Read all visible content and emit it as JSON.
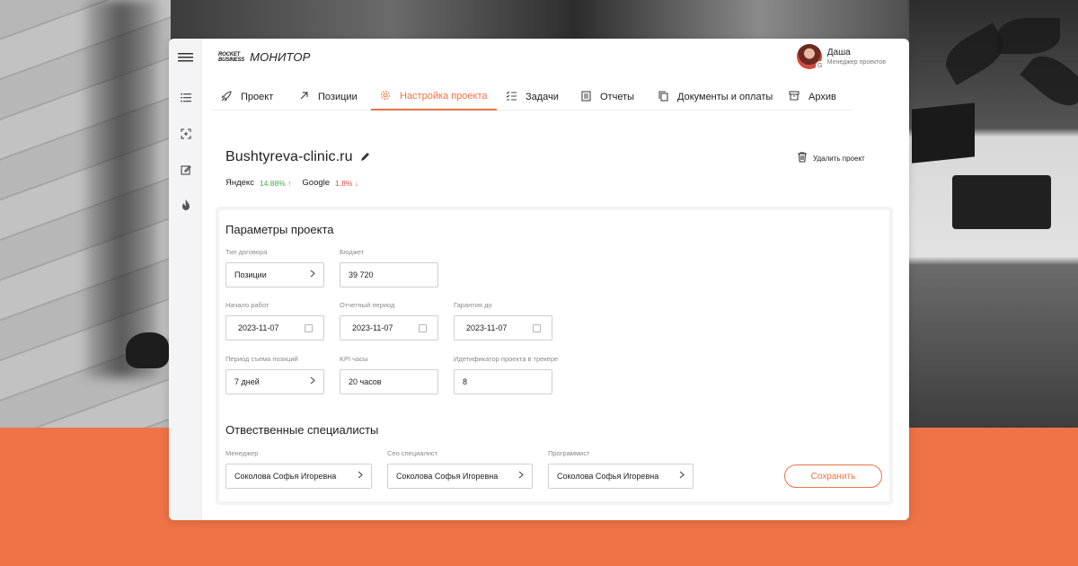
{
  "header": {
    "logo_small_1": "ROCKET",
    "logo_small_2": "BUSINESS",
    "logo_title": "МОНИТОР",
    "user_name": "Даша",
    "user_role": "Менеджер проектов",
    "avatar_badge": "G"
  },
  "sidebar": {
    "icons": [
      "menu-icon",
      "list-icon",
      "scan-icon",
      "edit-icon",
      "flame-icon"
    ]
  },
  "tabs": [
    {
      "label": "Проект",
      "icon": "rocket-icon"
    },
    {
      "label": "Позиции",
      "icon": "arrow-up-right-icon"
    },
    {
      "label": "Настройка проекта",
      "icon": "gear-icon",
      "active": true
    },
    {
      "label": "Задачи",
      "icon": "checklist-icon"
    },
    {
      "label": "Отчеты",
      "icon": "document-icon"
    },
    {
      "label": "Документы и оплаты",
      "icon": "copy-icon"
    },
    {
      "label": "Архив",
      "icon": "archive-icon"
    }
  ],
  "project": {
    "title": "Bushtyreva-clinic.ru",
    "delete_label": "Удалить проект",
    "stats": {
      "yandex_label": "Яндекс",
      "yandex_value": "14.88% ↑",
      "google_label": "Google",
      "google_value": "1.8% ↓"
    }
  },
  "params": {
    "title": "Параметры проекта",
    "contract_type_label": "Тип договора",
    "contract_type_value": "Позиции",
    "budget_label": "Бюджет",
    "budget_value": "39 720",
    "start_label": "Начало работ",
    "start_value": "2023-11-07",
    "report_label": "Отчетный период",
    "report_value": "2023-11-07",
    "warranty_label": "Гарантия до",
    "warranty_value": "2023-11-07",
    "period_label": "Период съема позиций",
    "period_value": "7 дней",
    "kpi_label": "KPI часы",
    "kpi_value": "20 часов",
    "tracker_label": "Идетификатор проекта в трекере",
    "tracker_value": "8"
  },
  "specialists": {
    "title": "Отвественные специалисты",
    "manager_label": "Менеджер",
    "manager_value": "Соколова Софья Игоревна",
    "seo_label": "Сео специалист",
    "seo_value": "Соколова Софья Игоревна",
    "dev_label": "Программист",
    "dev_value": "Соколова Софья Игоревна",
    "save_label": "Сохранить"
  },
  "colors": {
    "accent": "#ef7346",
    "up": "#3fae49",
    "down": "#e64545"
  }
}
